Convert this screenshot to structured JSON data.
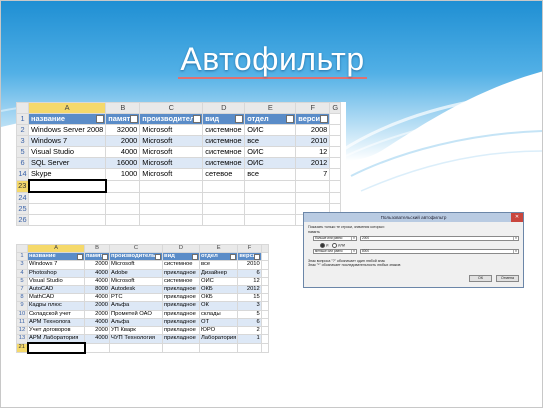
{
  "slide": {
    "title": "Автофильтр",
    "colors": {
      "sky_top": "#1f8fd3",
      "sky_bottom": "#ffffff",
      "header_fill": "#5a8cc8",
      "band_fill": "#dde8f6",
      "selection": "#f5d96b"
    }
  },
  "sheet1": {
    "columns": [
      "A",
      "B",
      "C",
      "D",
      "E",
      "F",
      "G"
    ],
    "selected_column": "A",
    "headers": [
      "название",
      "память",
      "производитель",
      "вид",
      "отдел",
      "версия"
    ],
    "rows": [
      {
        "num": "2",
        "cells": [
          "Windows Server 2008",
          "32000",
          "Microsoft",
          "системное",
          "ОИС",
          "2008"
        ]
      },
      {
        "num": "3",
        "cells": [
          "Windows 7",
          "2000",
          "Microsoft",
          "системное",
          "все",
          "2010"
        ]
      },
      {
        "num": "5",
        "cells": [
          "Visual Studio",
          "4000",
          "Microsoft",
          "системное",
          "ОИС",
          "12"
        ]
      },
      {
        "num": "6",
        "cells": [
          "SQL Server",
          "16000",
          "Microsoft",
          "системное",
          "ОИС",
          "2012"
        ]
      },
      {
        "num": "14",
        "cells": [
          "Skype",
          "1000",
          "Microsoft",
          "сетевое",
          "все",
          "7"
        ]
      }
    ],
    "empty_rows": [
      "23",
      "24",
      "25",
      "26"
    ],
    "active_row": "23"
  },
  "sheet2": {
    "columns": [
      "A",
      "B",
      "C",
      "D",
      "E",
      "F"
    ],
    "selected_column": "A",
    "headers": [
      "название",
      "память",
      "производитель",
      "вид",
      "отдел",
      "версия"
    ],
    "rows": [
      {
        "num": "3",
        "cells": [
          "Windows 7",
          "2000",
          "Microsoft",
          "системное",
          "все",
          "2010"
        ]
      },
      {
        "num": "4",
        "cells": [
          "Photoshop",
          "4000",
          "Adobe",
          "прикладное",
          "Дизайнер",
          "6"
        ]
      },
      {
        "num": "5",
        "cells": [
          "Visual Studio",
          "4000",
          "Microsoft",
          "системное",
          "ОИС",
          "12"
        ]
      },
      {
        "num": "7",
        "cells": [
          "AutoCAD",
          "8000",
          "Autodesk",
          "прикладное",
          "ОКБ",
          "2012"
        ]
      },
      {
        "num": "8",
        "cells": [
          "MathCAD",
          "4000",
          "PTC",
          "прикладное",
          "ОКБ",
          "15"
        ]
      },
      {
        "num": "9",
        "cells": [
          "Кадры плюс",
          "2000",
          "Альфа",
          "прикладное",
          "ОК",
          "3"
        ]
      },
      {
        "num": "10",
        "cells": [
          "Складской учет",
          "2000",
          "Прометей ОАО",
          "прикладное",
          "склады",
          "5"
        ]
      },
      {
        "num": "11",
        "cells": [
          "АРМ Технолога",
          "4000",
          "Альфа",
          "прикладное",
          "ОТ",
          "6"
        ]
      },
      {
        "num": "12",
        "cells": [
          "Учет договоров",
          "2000",
          "УП Кварк",
          "прикладное",
          "ЮРО",
          "2"
        ]
      },
      {
        "num": "13",
        "cells": [
          "АРМ Лаборатория",
          "4000",
          "ЧУП Технология",
          "прикладное",
          "Лаборатория",
          "1"
        ]
      }
    ],
    "empty_rows": [
      "21"
    ],
    "active_row": "21"
  },
  "dialog": {
    "title": "Пользовательский автофильтр",
    "prompt": "Показать только те строки, значения которых:",
    "field": "память",
    "cond1_op": "больше или равно",
    "cond1_val": "2000",
    "and_label": "И",
    "or_label": "ИЛИ",
    "selected_logic": "and",
    "cond2_op": "меньше или равно",
    "cond2_val": "8000",
    "hint1": "Знак вопроса \"?\" обозначает один любой знак",
    "hint2": "Знак \"*\" обозначает последовательность любых знаков",
    "ok_label": "ОК",
    "cancel_label": "Отмена"
  }
}
